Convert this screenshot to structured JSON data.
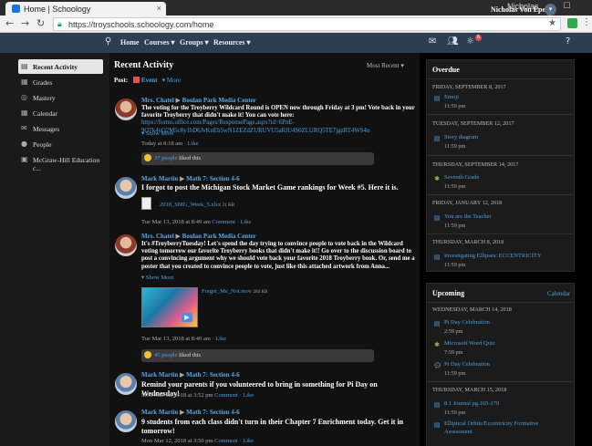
{
  "browser": {
    "tab_title": "Home | Schoology",
    "tab_close": "×",
    "user": "Nicholas",
    "window_controls": "‒ ☐ ✕",
    "url": "https://troyschools.schoology.com/home",
    "back": "←",
    "forward": "→",
    "reload": "↻",
    "star": "★",
    "menu": "⋮"
  },
  "header": {
    "nav": [
      "Home",
      "Courses ▾",
      "Groups ▾",
      "Resources ▾"
    ],
    "notification_count": "6",
    "user_name": "Nicholas Von Eper",
    "user_menu": "▾",
    "help": "?"
  },
  "sidebar": {
    "items": [
      {
        "label": "Recent Activity",
        "icon": "▤"
      },
      {
        "label": "Grades",
        "icon": "▦"
      },
      {
        "label": "Mastery",
        "icon": "◎"
      },
      {
        "label": "Calendar",
        "icon": "▦"
      },
      {
        "label": "Messages",
        "icon": "✉"
      },
      {
        "label": "People",
        "icon": "●"
      },
      {
        "label": "McGraw-Hill Education c...",
        "icon": "▣"
      }
    ]
  },
  "feed": {
    "title": "Recent Activity",
    "sort": "Most Recent ▾",
    "post_label": "Post:",
    "event": "Event",
    "more": "▾ More",
    "posts": [
      {
        "author": "Mrs. Chatel",
        "target": "Boulan Park Media Center",
        "body": "The voting for the Troyberry Wildcard Round is OPEN now through Friday at 3 pm! Vote back in your favorite Troyberry that didn't make it! You can vote here:",
        "link": "https://forms.office.com/Pages/ResponsePage.aspx?id=6PnE-9O7k4yO2M5c8y1hD6JvKnEb5wN1ZEZdZURUVU5aRlU4S0ZLURQ5TE7jgzRT4WS4u",
        "show_more": "▾ Show More",
        "meta_time": "Today at 8:18 am",
        "meta_like": "Like",
        "likes_link": "37 people",
        "likes_text": "liked this"
      },
      {
        "author": "Mark Martin",
        "target": "Math 7: Section 4-6",
        "body": "I forgot to post the Michigan Stock Market Game rankings for Week #5.  Here it is.",
        "file": "2018_SMG_Week_5.xlsx",
        "file_size": "21 KB",
        "meta_time": "Tue Mar 13, 2018 at 8:49 am",
        "meta_comment": "Comment",
        "meta_like": "Like"
      },
      {
        "author": "Mrs. Chatel",
        "target": "Boulan Park Media Center",
        "body": "It's #TroyberryTuesday!  Let's spend the day trying to convince people to vote back in the Wildcard voting tomorrow our favorite Troyberry books that didn't make it!!  Go over to the discussion board to post a convincing argument why we should vote back your favorite 2018 Troyberry book.  Or, send me a poster that you created to convince people to vote, just like this attached artwork from Anna...",
        "show_more": "▾ Show More",
        "file": "Forget_Me_Not.mov",
        "file_size": "284 KB",
        "meta_time": "Tue Mar 13, 2018 at 8:40 am",
        "meta_like": "Like",
        "likes_link": "45 people",
        "likes_text": "liked this"
      },
      {
        "author": "Mark Martin",
        "target": "Math 7: Section 4-6",
        "body": "Remind your parents if you volunteered to bring in something for Pi Day on Wednesday!",
        "meta_time": "Mon Mar 12, 2018 at 3:52 pm",
        "meta_comment": "Comment",
        "meta_like": "Like"
      },
      {
        "author": "Mark Martin",
        "target": "Math 7: Section 4-6",
        "body": "9 students from each class didn't turn in their Chapter 7 Enrichment today.  Get it in tomorrow!",
        "meta_time": "Mon Mar 12, 2018 at 3:50 pm",
        "meta_comment": "Comment",
        "meta_like": "Like"
      }
    ]
  },
  "overdue": {
    "title": "Overdue",
    "groups": [
      {
        "date": "FRIDAY, SEPTEMBER 8, 2017",
        "items": [
          {
            "name": "Emoji",
            "time": "11:59 pm"
          }
        ]
      },
      {
        "date": "TUESDAY, SEPTEMBER 12, 2017",
        "items": [
          {
            "name": "Story diagram",
            "time": "11:59 pm"
          }
        ]
      },
      {
        "date": "THURSDAY, SEPTEMBER 14, 2017",
        "items": [
          {
            "name": "Seventh Grade",
            "time": "11:59 pm"
          }
        ]
      },
      {
        "date": "FRIDAY, JANUARY 12, 2018",
        "items": [
          {
            "name": "You are the Teacher",
            "time": "11:59 pm"
          }
        ]
      },
      {
        "date": "THURSDAY, MARCH 8, 2018",
        "items": [
          {
            "name": "Investigating Ellipses: ECCENTRICITY",
            "time": "11:59 pm"
          }
        ]
      }
    ]
  },
  "upcoming": {
    "title": "Upcoming",
    "calendar": "Calendar",
    "groups": [
      {
        "date": "WEDNESDAY, MARCH 14, 2018",
        "items": [
          {
            "name": "Pi Day Celebration",
            "time": "2:59 pm"
          },
          {
            "name": "Microsoft Word Quiz",
            "time": "7:59 pm"
          },
          {
            "name": "Pi Day Celebration",
            "time": "11:59 pm"
          }
        ]
      },
      {
        "date": "THURSDAY, MARCH 15, 2018",
        "items": [
          {
            "name": "8.1 Journal pg.165-170",
            "time": "11:59 pm"
          },
          {
            "name": "Elliptical Orbits/Eccentricity Formative",
            "name2": "Assessment"
          }
        ]
      }
    ]
  }
}
